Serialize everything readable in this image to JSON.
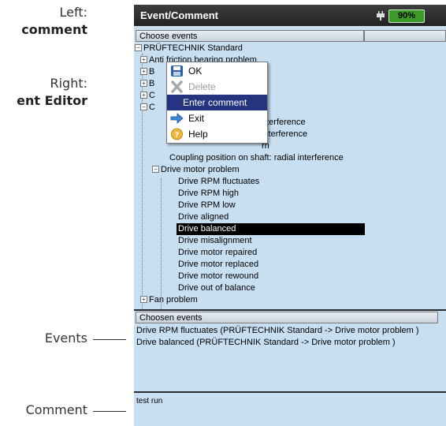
{
  "annotations": {
    "left_label": "Left:",
    "left_value": "comment",
    "right_label": "Right:",
    "right_value": "ent Editor",
    "events_label": "Events",
    "comment_label": "Comment"
  },
  "titlebar": {
    "title": "Event/Comment",
    "battery": "90%"
  },
  "choose_header": "Choose events",
  "tree": {
    "root": "PRÜFTECHNIK Standard",
    "items": [
      "Anti friction bearing problem",
      "B",
      "B",
      "C",
      "C"
    ],
    "partial": [
      "nterference",
      "interference",
      "rn"
    ],
    "coupling_item": "Coupling position on shaft: radial interference",
    "drive_group": "Drive motor problem",
    "drive_items": [
      "Drive RPM fluctuates",
      "Drive RPM high",
      "Drive RPM low",
      "Drive aligned",
      "Drive balanced",
      "Drive misalignment",
      "Drive motor repaired",
      "Drive motor replaced",
      "Drive motor rewound",
      "Drive out of balance"
    ],
    "fan_group": "Fan problem"
  },
  "chosen_header": "Choosen events",
  "chosen_events": [
    "Drive RPM fluctuates (PRÜFTECHNIK Standard -> Drive motor problem )",
    "Drive balanced (PRÜFTECHNIK Standard -> Drive motor problem )"
  ],
  "comment_text": "test run",
  "menu": {
    "ok": "OK",
    "delete": "Delete",
    "enter_comment": "Enter comment",
    "exit": "Exit",
    "help": "Help"
  }
}
